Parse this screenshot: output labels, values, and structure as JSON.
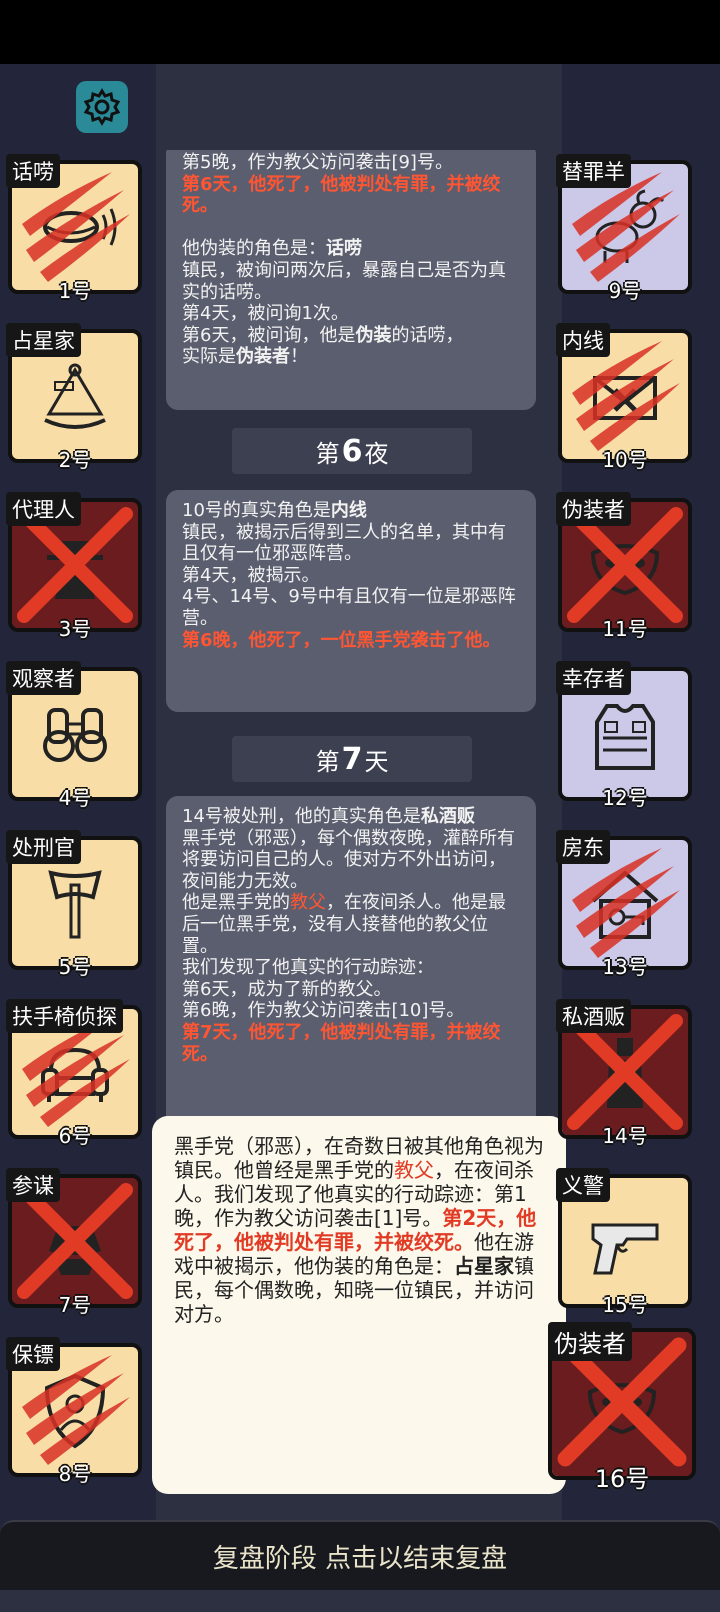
{
  "footer": {
    "label": "复盘阶段 点击以结束复盘"
  },
  "left_players": [
    {
      "role": "话唠",
      "seat": "1号",
      "icon": "mouth-icon",
      "team": "town",
      "status": "attacked"
    },
    {
      "role": "占星家",
      "seat": "2号",
      "icon": "sextant-icon",
      "team": "town",
      "status": "alive"
    },
    {
      "role": "代理人",
      "seat": "3号",
      "icon": "spy-icon",
      "team": "evil",
      "status": "executed"
    },
    {
      "role": "观察者",
      "seat": "4号",
      "icon": "binoculars-icon",
      "team": "town",
      "status": "alive"
    },
    {
      "role": "处刑官",
      "seat": "5号",
      "icon": "axe-icon",
      "team": "town",
      "status": "alive"
    },
    {
      "role": "扶手椅侦探",
      "seat": "6号",
      "icon": "armchair-icon",
      "team": "town",
      "status": "attacked"
    },
    {
      "role": "参谋",
      "seat": "7号",
      "icon": "hat-icon",
      "team": "evil",
      "status": "executed"
    },
    {
      "role": "保镖",
      "seat": "8号",
      "icon": "shield-icon",
      "team": "town",
      "status": "attacked"
    }
  ],
  "right_players": [
    {
      "role": "替罪羊",
      "seat": "9号",
      "icon": "goat-icon",
      "team": "outsider",
      "status": "attacked"
    },
    {
      "role": "内线",
      "seat": "10号",
      "icon": "envelope-icon",
      "team": "town",
      "status": "attacked"
    },
    {
      "role": "伪装者",
      "seat": "11号",
      "icon": "mask-icon",
      "team": "evil",
      "status": "executed"
    },
    {
      "role": "幸存者",
      "seat": "12号",
      "icon": "vest-icon",
      "team": "outsider",
      "status": "alive"
    },
    {
      "role": "房东",
      "seat": "13号",
      "icon": "house-key-icon",
      "team": "outsider",
      "status": "attacked"
    },
    {
      "role": "私酒贩",
      "seat": "14号",
      "icon": "bottle-icon",
      "team": "evil",
      "status": "executed"
    },
    {
      "role": "义警",
      "seat": "15号",
      "icon": "pistol-icon",
      "team": "town",
      "status": "alive"
    },
    {
      "role": "伪装者",
      "seat": "16号",
      "icon": "mask-icon",
      "team": "evil",
      "status": "executed"
    }
  ],
  "log": {
    "block1": [
      {
        "text": "第5晚，作为教父访问袭击[9]号。",
        "style": "normal"
      },
      {
        "text": "第6天，他死了，他被判处有罪，并被绞死。",
        "style": "red"
      },
      {
        "text": "",
        "style": "normal"
      },
      {
        "pre": "他伪装的角色是：",
        "bold": "话唠"
      },
      {
        "text": "镇民，被询问两次后，暴露自己是否为真实的话唠。",
        "style": "normal"
      },
      {
        "text": "第4天，被问询1次。",
        "style": "normal"
      },
      {
        "pre": "第6天，被问询，他是",
        "bold": "伪装",
        "post": "的话唠，"
      },
      {
        "pre": "实际是",
        "bold": "伪装者",
        "post": "！"
      }
    ],
    "header1": {
      "pre": "第",
      "num": "6",
      "post": "夜"
    },
    "block2": [
      {
        "pre": "10号的真实角色是",
        "bold": "内线"
      },
      {
        "text": "镇民，被揭示后得到三人的名单，其中有且仅有一位邪恶阵营。",
        "style": "normal"
      },
      {
        "text": "第4天，被揭示。",
        "style": "normal"
      },
      {
        "text": "4号、14号、9号中有且仅有一位是邪恶阵营。",
        "style": "normal"
      },
      {
        "text": "第6晚，他死了，一位黑手党袭击了他。",
        "style": "red"
      }
    ],
    "header2": {
      "pre": "第",
      "num": "7",
      "post": "天"
    },
    "block3": [
      {
        "pre": "14号被处刑，他的真实角色是",
        "bold": "私酒贩"
      },
      {
        "text": "黑手党（邪恶），每个偶数夜晚，灌醉所有将要访问自己的人。使对方不外出访问，夜间能力无效。",
        "style": "normal"
      },
      {
        "pre": "他是黑手党的",
        "redname": "教父",
        "post": "，在夜间杀人。他是最后一位黑手党，没有人接替他的教父位置。"
      },
      {
        "text": "我们发现了他真实的行动踪迹：",
        "style": "normal"
      },
      {
        "text": "第6天，成为了新的教父。",
        "style": "normal"
      },
      {
        "text": "第6晚，作为教父访问袭击[10]号。",
        "style": "normal"
      },
      {
        "text": "第7天，他死了，他被判处有罪，并被绞死。",
        "style": "red"
      }
    ]
  },
  "popup": [
    {
      "text": "黑手党（邪恶），在奇数日被其他角色视为镇民。",
      "style": "normal"
    },
    {
      "pre": "他曾经是黑手党的",
      "redname": "教父",
      "post": "，在夜间杀人。"
    },
    {
      "text": "我们发现了他真实的行动踪迹：",
      "style": "normal"
    },
    {
      "text": "第1晚，作为教父访问袭击[1]号。",
      "style": "normal"
    },
    {
      "text": "第2天，他死了，他被判处有罪，并被绞死。",
      "style": "red"
    },
    {
      "pre": "他在游戏中被揭示，他伪装的角色是：",
      "bold": "占星家"
    },
    {
      "text": "镇民，每个偶数晚，知晓一位镇民，并访问对方。",
      "style": "normal"
    }
  ]
}
